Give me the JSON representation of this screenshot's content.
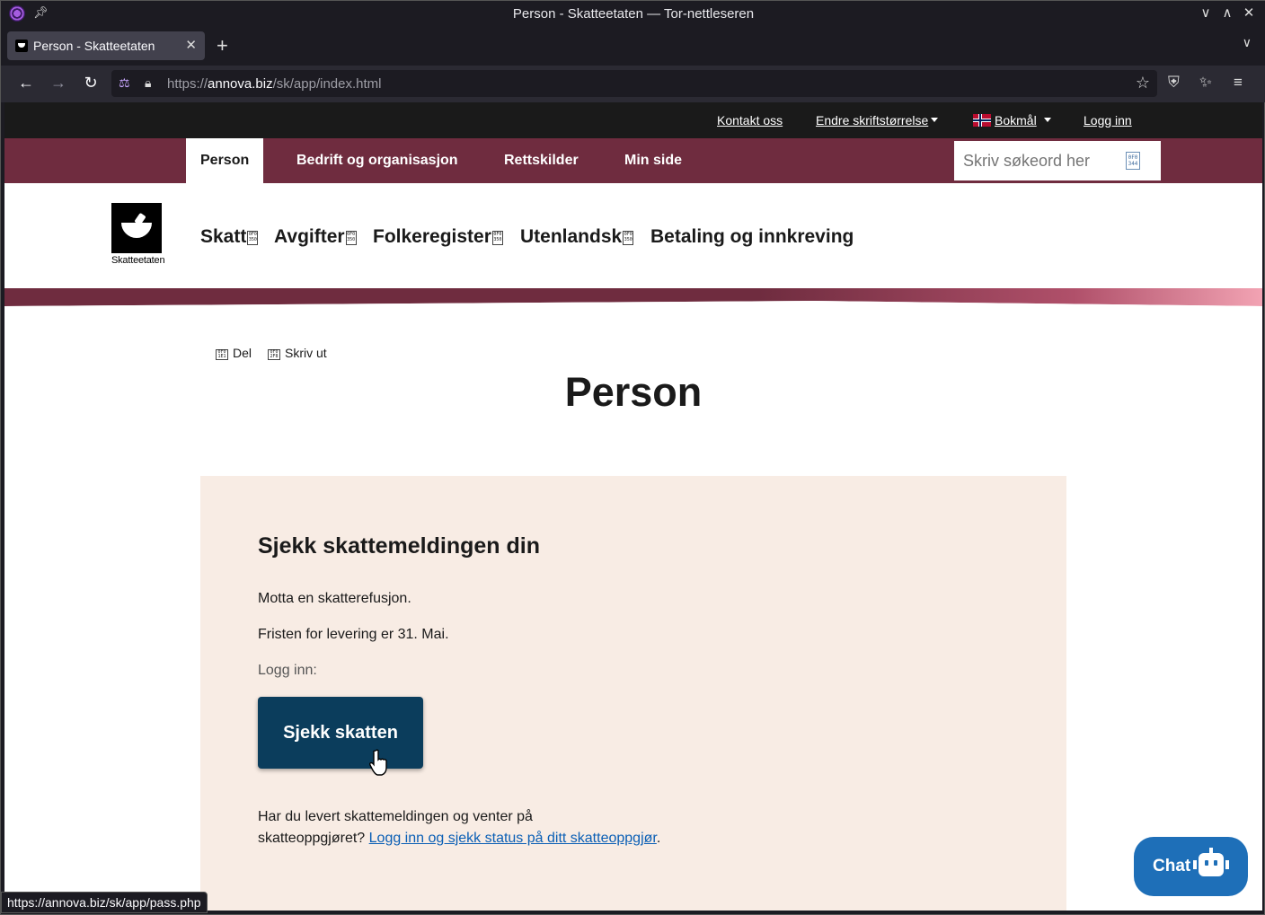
{
  "window": {
    "title": "Person - Skatteetaten — Tor-nettleseren"
  },
  "tabs": [
    {
      "label": "Person - Skatteetaten"
    }
  ],
  "urlbar": {
    "scheme": "https://",
    "host": "annova.biz",
    "path": "/sk/app/index.html"
  },
  "site": {
    "topbar": {
      "contact": "Kontakt oss",
      "font_size": "Endre skriftstørrelse",
      "language": "Bokmål",
      "login": "Logg inn"
    },
    "mainnav": {
      "items": [
        "Person",
        "Bedrift og organisasjon",
        "Rettskilder",
        "Min side"
      ],
      "active": "Person"
    },
    "search": {
      "placeholder": "Skriv søkeord her",
      "icon_glyph": "0F0 344"
    },
    "logo_text": "Skatteetaten",
    "subnav": {
      "items": [
        "Skatt",
        "Avgifter",
        "Folkeregister",
        "Utenlandsk",
        "Betaling og innkreving"
      ],
      "glyph": "0F0 350"
    },
    "tools": {
      "share": "Del",
      "share_glyph": "0F0 1E1",
      "print": "Skriv ut",
      "print_glyph": "0F0 2F8"
    },
    "page_title": "Person",
    "card": {
      "heading": "Sjekk skattemeldingen din",
      "line1": "Motta en skatterefusjon.",
      "line2": "Fristen for levering er 31. Mai.",
      "login_label": "Logg inn:",
      "button": "Sjekk skatten",
      "footer_text_1": "Har du levert skattemeldingen og venter på",
      "footer_text_2": "skatteoppgjøret?",
      "footer_link": "Logg inn og sjekk status på ditt skatteoppgjør",
      "footer_end": "."
    },
    "chat": {
      "label": "Chat"
    }
  },
  "statusbar": {
    "url": "https://annova.biz/sk/app/pass.php"
  },
  "colors": {
    "nav_bg": "#6f2c3f",
    "topbar_bg": "#1a1a1a",
    "card_bg": "#f8ece4",
    "button_bg": "#0b3d5c",
    "chat_bg": "#1e6fb8",
    "link": "#0b5fb5"
  }
}
